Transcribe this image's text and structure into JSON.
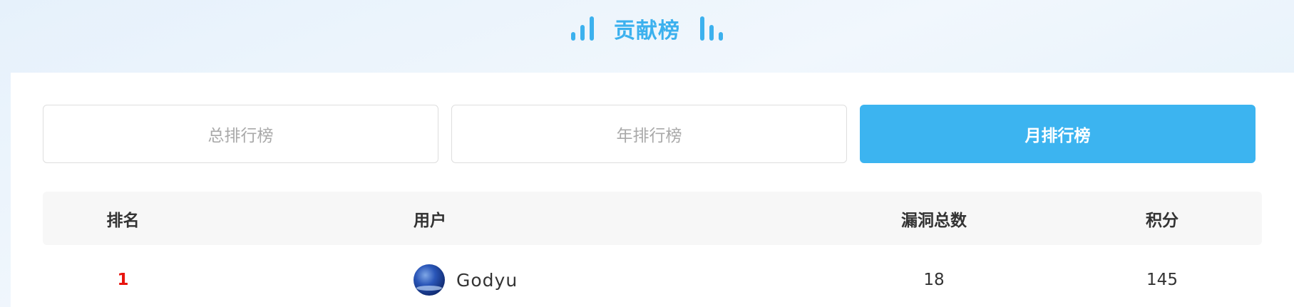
{
  "header": {
    "title": "贡献榜"
  },
  "tabs": [
    {
      "label": "总排行榜",
      "active": false
    },
    {
      "label": "年排行榜",
      "active": false
    },
    {
      "label": "月排行榜",
      "active": true
    }
  ],
  "table": {
    "columns": [
      "排名",
      "用户",
      "漏洞总数",
      "积分"
    ],
    "rows": [
      {
        "rank": "1",
        "user": "Godyu",
        "vulns": "18",
        "score": "145"
      }
    ]
  },
  "colors": {
    "accent": "#3cb4f0",
    "rank_highlight": "#e8140e"
  }
}
